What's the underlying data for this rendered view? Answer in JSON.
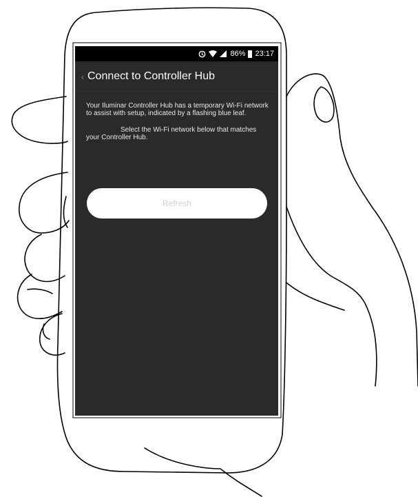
{
  "status_bar": {
    "icons": [
      "sync-icon",
      "wifi-icon",
      "signal-icon",
      "battery-icon"
    ],
    "battery": "86%",
    "time": "23:17"
  },
  "app_bar": {
    "back_icon": "chevron-left-icon",
    "title": "Connect to Controller Hub"
  },
  "content": {
    "intro": "Your Iluminar Controller Hub has a temporary Wi-Fi network to assist with setup, indicated by a flashing blue leaf.",
    "select": "Select the Wi-Fi network below that matches your Controller Hub.",
    "refresh_label": "Refresh"
  },
  "colors": {
    "screen_background": "#2a2a2a",
    "status_bar": "#000000",
    "button": "#ffffff",
    "button_text": "#d0d0d0"
  }
}
